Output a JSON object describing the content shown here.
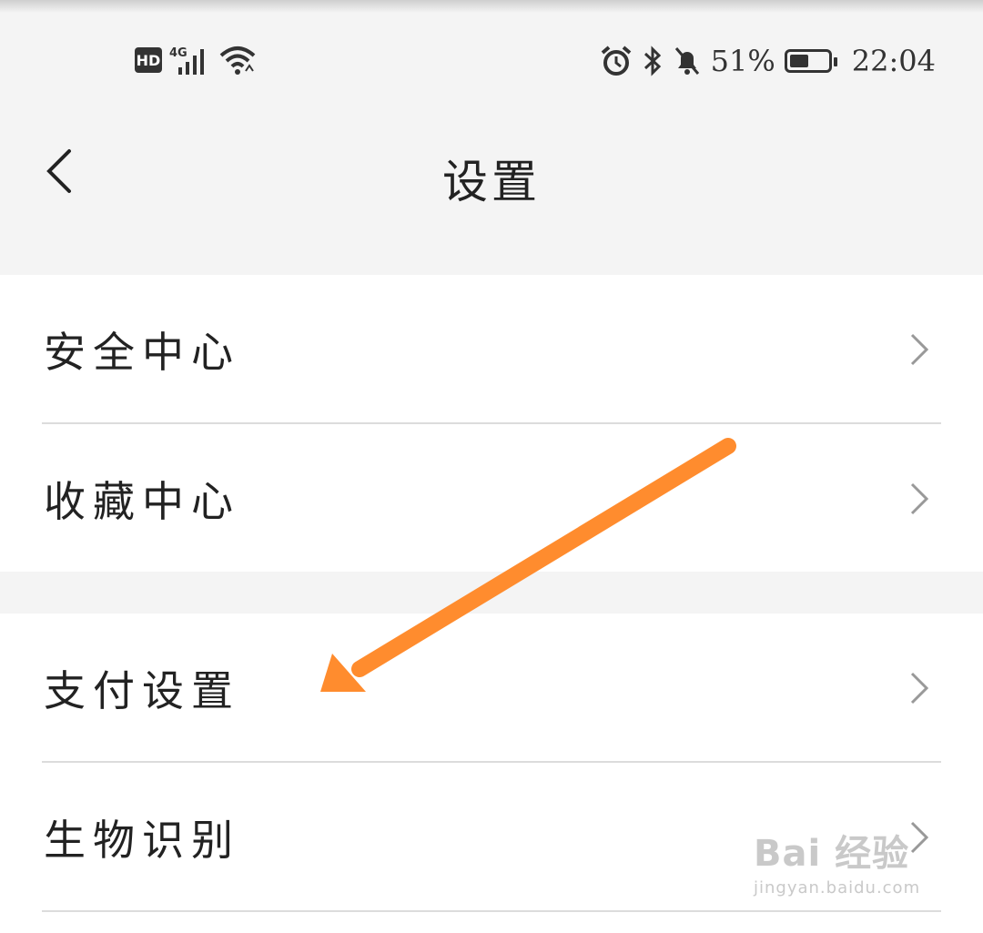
{
  "status_bar": {
    "left_badge": "HD",
    "network": "4G",
    "battery_percent": "51%",
    "battery_level": 0.51,
    "time": "22:04",
    "icons": [
      "signal-icon",
      "wifi-icon",
      "alarm-icon",
      "bluetooth-icon",
      "mute-bell-icon",
      "battery-icon"
    ]
  },
  "header": {
    "title": "设置",
    "back_icon": "back-arrow-icon"
  },
  "groups": [
    {
      "items": [
        {
          "label": "安全中心"
        },
        {
          "label": "收藏中心"
        }
      ]
    },
    {
      "items": [
        {
          "label": "支付设置"
        },
        {
          "label": "生物识别"
        }
      ]
    }
  ],
  "annotation": {
    "color": "#ff8c2e",
    "points_to": "支付设置"
  },
  "watermark": {
    "main": "Bai 经验",
    "sub": "jingyan.baidu.com"
  }
}
